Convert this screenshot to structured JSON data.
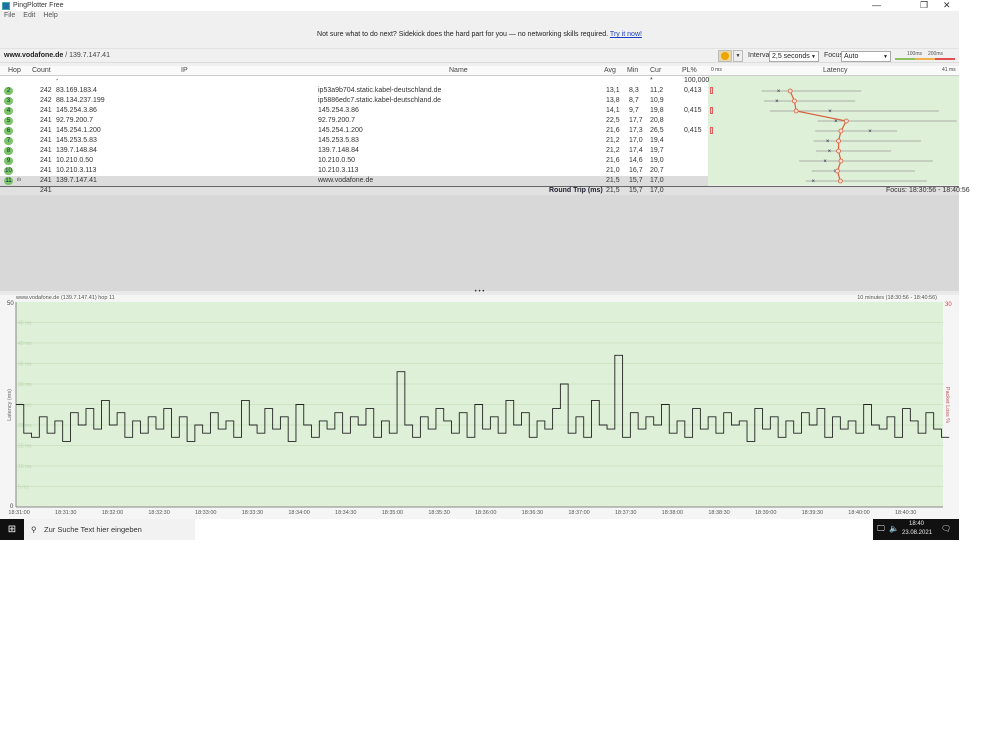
{
  "window": {
    "title": "PingPlotter Free",
    "minimize": "—",
    "restore": "❐",
    "close": "✕"
  },
  "menu": [
    "File",
    "Edit",
    "Help"
  ],
  "banner": {
    "text": "Not sure what to do next? Sidekick does the hard part for you — no networking skills required.",
    "link": "Try it now!"
  },
  "target": {
    "host": "www.vodafone.de",
    "ip": " / 139.7.147.41"
  },
  "toolbar": {
    "interval_label": "Interval",
    "interval_value": "2,5 seconds",
    "focus_label": "Focus",
    "focus_value": "Auto",
    "scale_100": "100ms",
    "scale_200": "200ms",
    "colors": {
      "good": "#8cc060",
      "warn": "#f0b050",
      "bad": "#e05050"
    }
  },
  "table": {
    "headers": {
      "hop": "Hop",
      "count": "Count",
      "ip": "IP",
      "name": "Name",
      "avg": "Avg",
      "min": "Min",
      "cur": "Cur",
      "pl": "PL%",
      "latency": "Latency",
      "lat_min": "0 ms",
      "lat_max": "41 ms"
    },
    "rows": [
      {
        "hop": "",
        "count": "",
        "ip": "-",
        "name": "",
        "avg": "",
        "min": "",
        "cur": "*",
        "pl": "100,000",
        "max": null
      },
      {
        "hop": "2",
        "count": "242",
        "ip": "83.169.183.4",
        "name": "ip53a9b704.static.kabel-deutschland.de",
        "avg": "13,1",
        "min": "8,3",
        "cur": "11,2",
        "pl": "0,413",
        "max": 25
      },
      {
        "hop": "3",
        "count": "242",
        "ip": "88.134.237.199",
        "name": "ip5886edc7.static.kabel-deutschland.de",
        "avg": "13,8",
        "min": "8,7",
        "cur": "10,9",
        "pl": "",
        "max": 24
      },
      {
        "hop": "4",
        "count": "241",
        "ip": "145.254.3.86",
        "name": "145.254.3.86",
        "avg": "14,1",
        "min": "9,7",
        "cur": "19,8",
        "pl": "0,415",
        "max": 38
      },
      {
        "hop": "5",
        "count": "241",
        "ip": "92.79.200.7",
        "name": "92.79.200.7",
        "avg": "22,5",
        "min": "17,7",
        "cur": "20,8",
        "pl": "",
        "max": 41
      },
      {
        "hop": "6",
        "count": "241",
        "ip": "145.254.1.200",
        "name": "145.254.1.200",
        "avg": "21,6",
        "min": "17,3",
        "cur": "26,5",
        "pl": "0,415",
        "max": 31
      },
      {
        "hop": "7",
        "count": "241",
        "ip": "145.253.5.83",
        "name": "145.253.5.83",
        "avg": "21,2",
        "min": "17,0",
        "cur": "19,4",
        "pl": "",
        "max": 35
      },
      {
        "hop": "8",
        "count": "241",
        "ip": "139.7.148.84",
        "name": "139.7.148.84",
        "avg": "21,2",
        "min": "17,4",
        "cur": "19,7",
        "pl": "",
        "max": 30
      },
      {
        "hop": "9",
        "count": "241",
        "ip": "10.210.0.50",
        "name": "10.210.0.50",
        "avg": "21,6",
        "min": "14,6",
        "cur": "19,0",
        "pl": "",
        "max": 37
      },
      {
        "hop": "10",
        "count": "241",
        "ip": "10.210.3.113",
        "name": "10.210.3.113",
        "avg": "21,0",
        "min": "16,7",
        "cur": "20,7",
        "pl": "",
        "max": 34
      },
      {
        "hop": "11",
        "count": "241",
        "ip": "139.7.147.41",
        "name": "www.vodafone.de",
        "avg": "21,5",
        "min": "15,7",
        "cur": "17,0",
        "pl": "",
        "max": 36
      }
    ],
    "summary": {
      "count": "241",
      "label": "Round Trip (ms)",
      "avg": "21,5",
      "min": "15,7",
      "cur": "17,0",
      "focus": "Focus: 18:30:56 - 18:40:56"
    }
  },
  "chart_data": {
    "type": "line",
    "title": "www.vodafone.de (139.7.147.41) hop 11",
    "range_label": "10 minutes (18:30:56 - 18:40:56)",
    "ylabel": "Latency (ms)",
    "y2label": "Packet Loss %",
    "ylim": [
      0,
      50
    ],
    "y_top_label": "50",
    "y_bottom_label": "0",
    "y2_top_label": "30",
    "gridlines": [
      "45 ms",
      "40 ms",
      "35 ms",
      "30 ms",
      "25 ms",
      "20 ms",
      "15 ms",
      "10 ms",
      "5 ms"
    ],
    "grid_values": [
      45,
      40,
      35,
      30,
      25,
      20,
      15,
      10,
      5
    ],
    "x_ticks": [
      "18:31:00",
      "18:31:30",
      "18:32:00",
      "18:32:30",
      "18:33:00",
      "18:33:30",
      "18:34:00",
      "18:34:30",
      "18:35:00",
      "18:35:30",
      "18:36:00",
      "18:36:30",
      "18:37:00",
      "18:37:30",
      "18:38:00",
      "18:38:30",
      "18:39:00",
      "18:39:30",
      "18:40:00",
      "18:40:30"
    ],
    "x_start_offset_s": -2,
    "x_end_offset_s": 594,
    "sample_interval_s": 5,
    "values": [
      25,
      18,
      17,
      22,
      18,
      21,
      16,
      23,
      20,
      24,
      19,
      26,
      20,
      23,
      17,
      21,
      18,
      22,
      19,
      24,
      17,
      22,
      16,
      20,
      18,
      23,
      19,
      21,
      17,
      26,
      20,
      18,
      24,
      19,
      22,
      16,
      25,
      20,
      17,
      21,
      19,
      23,
      18,
      22,
      20,
      24,
      17,
      21,
      18,
      33,
      20,
      17,
      22,
      19,
      24,
      21,
      18,
      23,
      17,
      25,
      19,
      22,
      18,
      26,
      20,
      23,
      17,
      21,
      19,
      24,
      30,
      18,
      22,
      17,
      26,
      20,
      19,
      37,
      17,
      23,
      19,
      22,
      20,
      25,
      18,
      21,
      17,
      24,
      19,
      22,
      18,
      23,
      20,
      21,
      16,
      24,
      19,
      22,
      17,
      21,
      18,
      23,
      20,
      24,
      17,
      22,
      19,
      21,
      18,
      25,
      20,
      19,
      22,
      17,
      24,
      21,
      18,
      23,
      19,
      17
    ]
  },
  "taskbar": {
    "search": "Zur Suche Text hier eingeben",
    "time": "18:40",
    "date": "23.08.2021"
  }
}
